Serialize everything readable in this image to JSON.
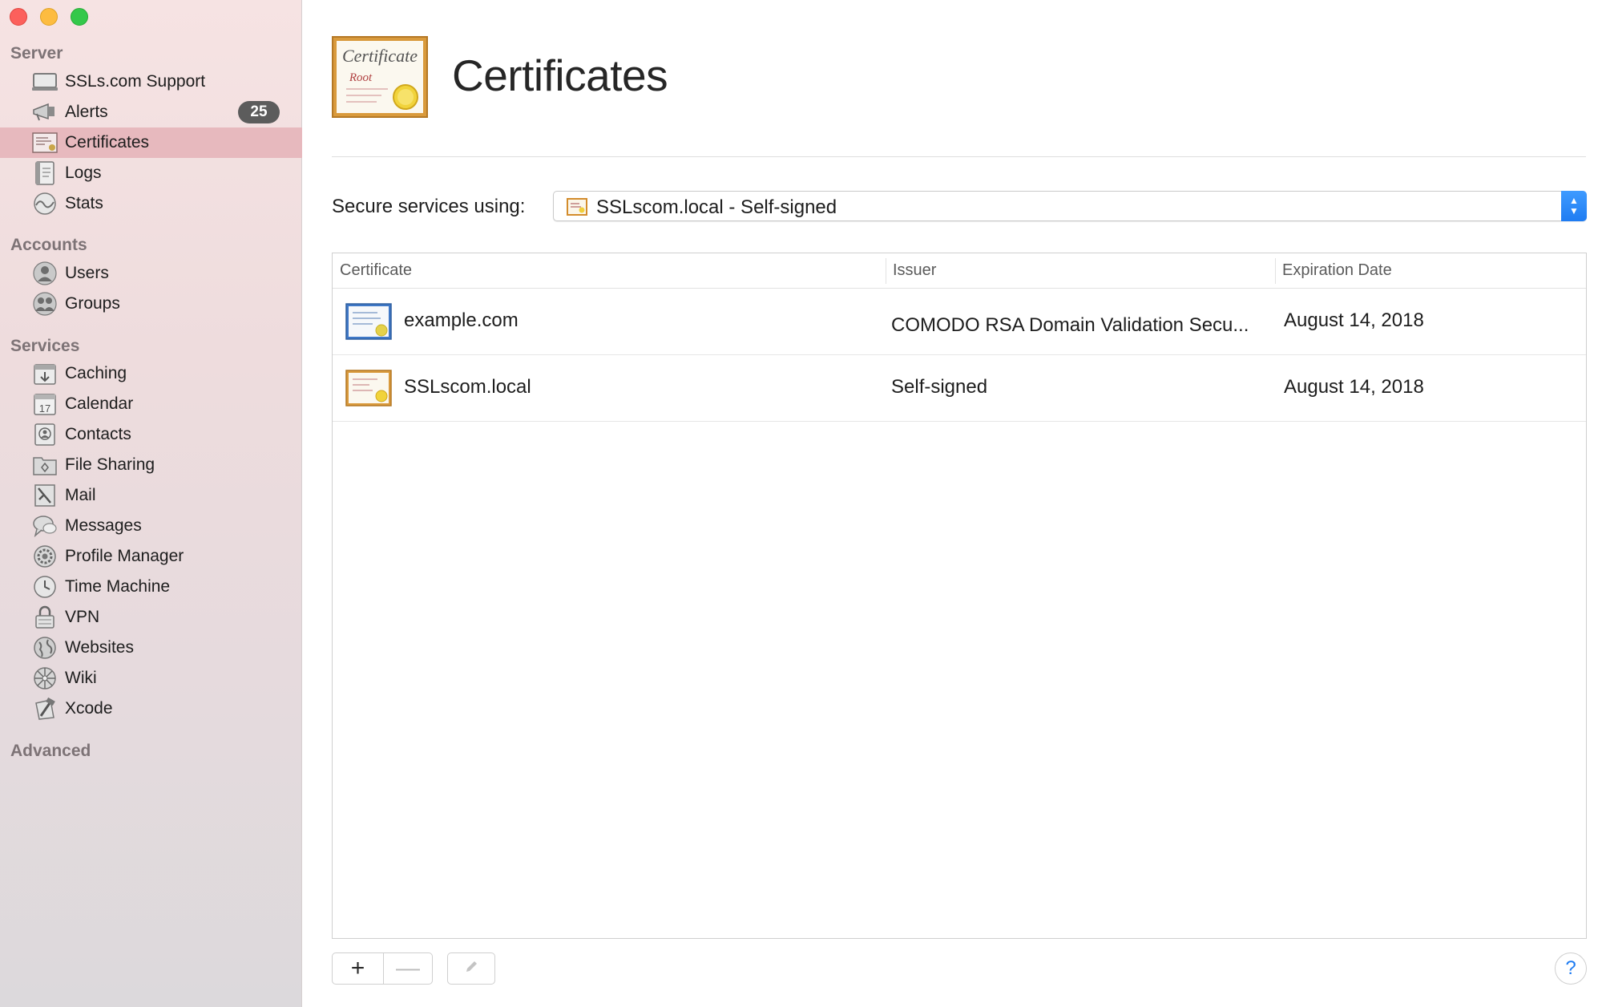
{
  "colors": {
    "selection": "#e7b9be",
    "accent": "#1f7cf2",
    "badge": "#5c5c5c"
  },
  "sidebar": {
    "sections": {
      "server": "Server",
      "accounts": "Accounts",
      "services": "Services",
      "advanced": "Advanced"
    },
    "server_items": [
      {
        "label": "SSLs.com Support",
        "icon": "server-icon"
      },
      {
        "label": "Alerts",
        "icon": "megaphone-icon",
        "badge": "25"
      },
      {
        "label": "Certificates",
        "icon": "certificate-icon",
        "selected": true
      },
      {
        "label": "Logs",
        "icon": "log-book-icon"
      },
      {
        "label": "Stats",
        "icon": "stats-icon"
      }
    ],
    "account_items": [
      {
        "label": "Users",
        "icon": "user-icon"
      },
      {
        "label": "Groups",
        "icon": "group-icon"
      }
    ],
    "service_items": [
      {
        "label": "Caching",
        "icon": "caching-icon"
      },
      {
        "label": "Calendar",
        "icon": "calendar-icon",
        "icon_text": "17"
      },
      {
        "label": "Contacts",
        "icon": "contacts-icon"
      },
      {
        "label": "File Sharing",
        "icon": "file-sharing-icon"
      },
      {
        "label": "Mail",
        "icon": "mail-icon"
      },
      {
        "label": "Messages",
        "icon": "messages-icon"
      },
      {
        "label": "Profile Manager",
        "icon": "profile-manager-icon"
      },
      {
        "label": "Time Machine",
        "icon": "time-machine-icon"
      },
      {
        "label": "VPN",
        "icon": "vpn-lock-icon"
      },
      {
        "label": "Websites",
        "icon": "globe-icon"
      },
      {
        "label": "Wiki",
        "icon": "wiki-icon"
      },
      {
        "label": "Xcode",
        "icon": "xcode-hammer-icon"
      }
    ]
  },
  "main": {
    "title": "Certificates",
    "page_icon_text": {
      "line1": "Certificate",
      "line2": "Root"
    },
    "secure_label": "Secure services using:",
    "secure_value": "SSLscom.local - Self-signed",
    "table": {
      "columns": [
        "Certificate",
        "Issuer",
        "Expiration Date"
      ],
      "rows": [
        {
          "certificate": "example.com",
          "issuer": "COMODO RSA Domain Validation Secu...",
          "expiration": "August 14, 2018",
          "icon": "standard-certificate-icon"
        },
        {
          "certificate": "SSLscom.local",
          "issuer": "Self-signed",
          "expiration": "August 14, 2018",
          "icon": "root-certificate-icon"
        }
      ]
    },
    "buttons": {
      "add": "+",
      "remove": "—",
      "help": "?"
    }
  }
}
